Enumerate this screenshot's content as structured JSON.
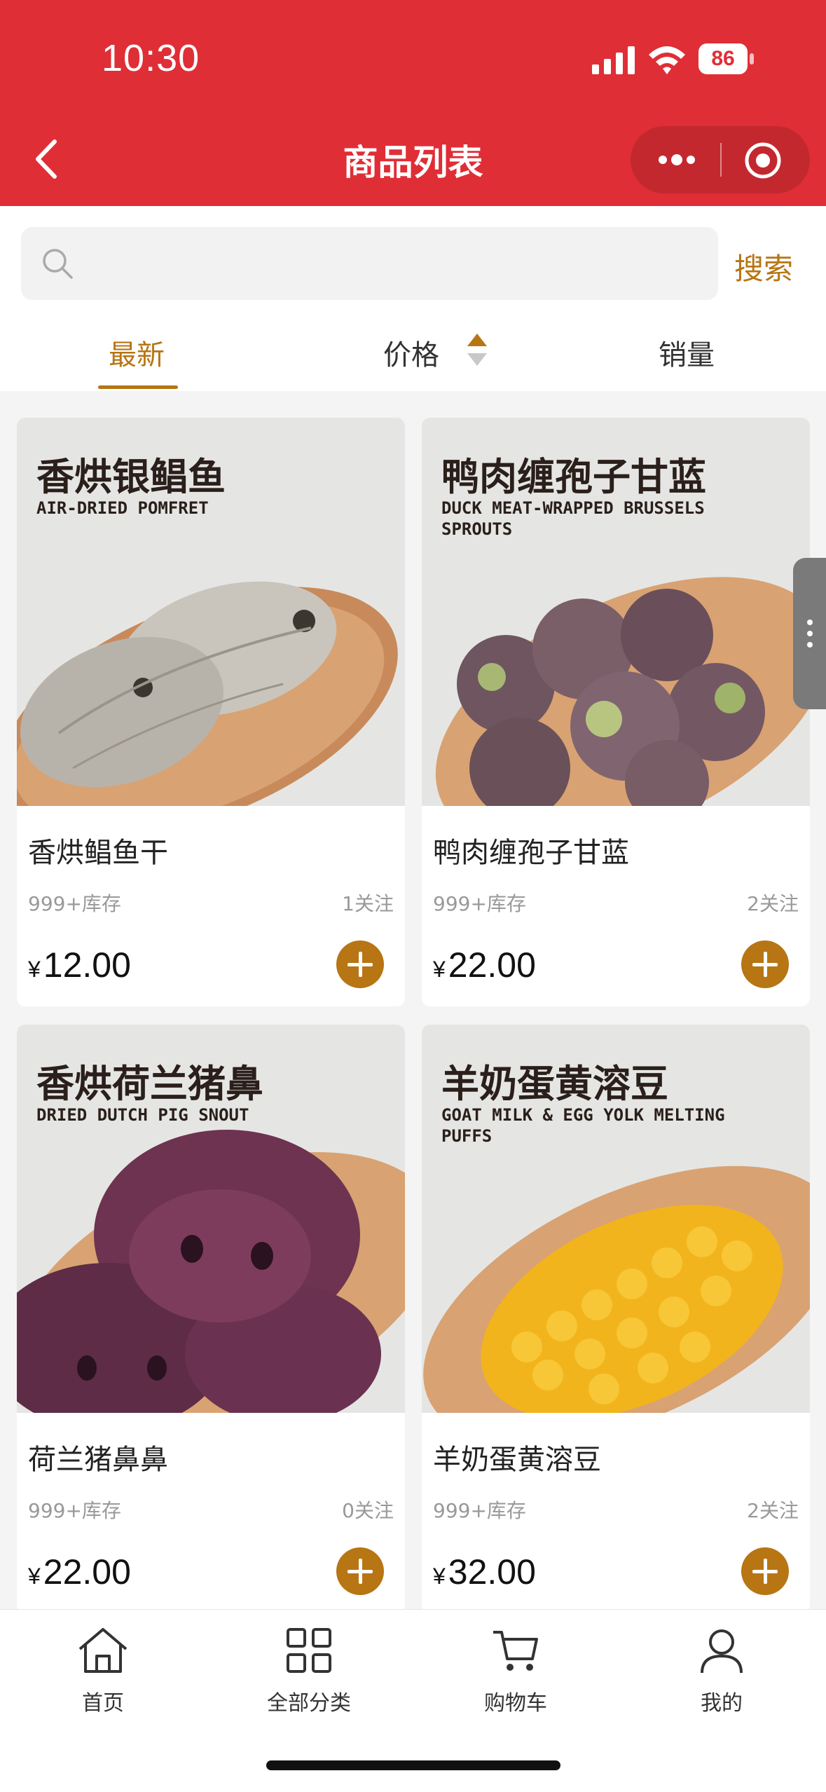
{
  "status_bar": {
    "time": "10:30",
    "battery": "86"
  },
  "nav": {
    "title": "商品列表"
  },
  "search": {
    "placeholder": "",
    "button": "搜索"
  },
  "sort_tabs": [
    {
      "label": "最新",
      "active": true
    },
    {
      "label": "价格",
      "active": false
    },
    {
      "label": "销量",
      "active": false
    }
  ],
  "products": [
    {
      "img_title": "香烘银鲳鱼",
      "img_subtitle": "AIR-DRIED POMFRET",
      "name": "香烘鲳鱼干",
      "stock": "999+库存",
      "follow": "1关注",
      "currency": "¥",
      "price": "12.00"
    },
    {
      "img_title": "鸭肉缠孢子甘蓝",
      "img_subtitle": "DUCK MEAT-WRAPPED BRUSSELS SPROUTS",
      "name": "鸭肉缠孢子甘蓝",
      "stock": "999+库存",
      "follow": "2关注",
      "currency": "¥",
      "price": "22.00"
    },
    {
      "img_title": "香烘荷兰猪鼻",
      "img_subtitle": "DRIED DUTCH PIG SNOUT",
      "name": "荷兰猪鼻鼻",
      "stock": "999+库存",
      "follow": "0关注",
      "currency": "¥",
      "price": "22.00"
    },
    {
      "img_title": "羊奶蛋黄溶豆",
      "img_subtitle": "GOAT MILK & EGG YOLK MELTING PUFFS",
      "name": "羊奶蛋黄溶豆",
      "stock": "999+库存",
      "follow": "2关注",
      "currency": "¥",
      "price": "32.00"
    }
  ],
  "tabbar": [
    {
      "label": "首页",
      "icon": "home-icon"
    },
    {
      "label": "全部分类",
      "icon": "grid-icon"
    },
    {
      "label": "购物车",
      "icon": "cart-icon"
    },
    {
      "label": "我的",
      "icon": "user-icon"
    }
  ],
  "colors": {
    "header": "#e02e36",
    "accent": "#b77514"
  }
}
